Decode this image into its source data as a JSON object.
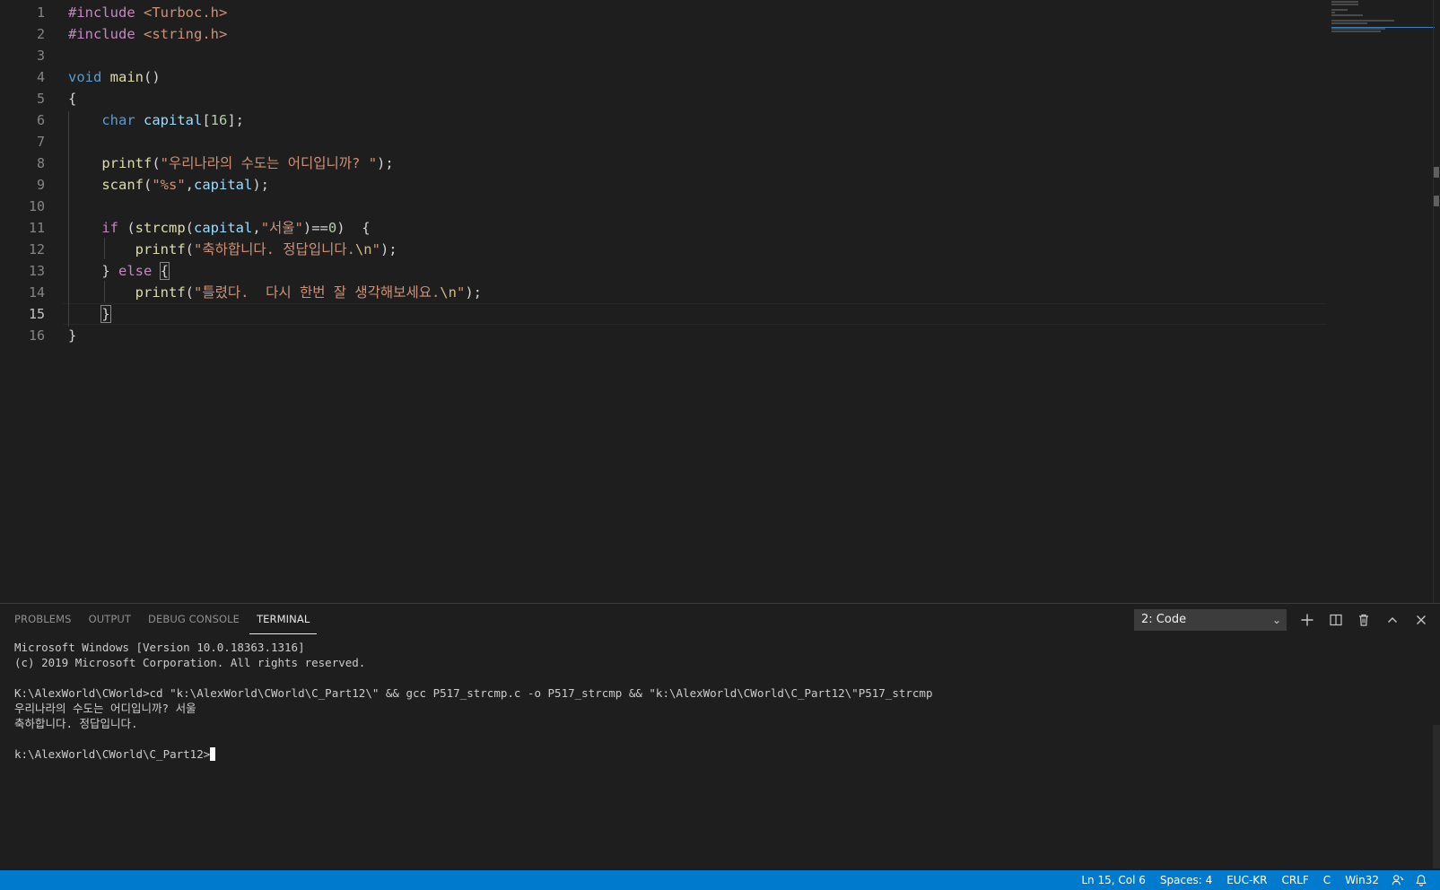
{
  "editor": {
    "line_numbers": [
      "1",
      "2",
      "3",
      "4",
      "5",
      "6",
      "7",
      "8",
      "9",
      "10",
      "11",
      "12",
      "13",
      "14",
      "15",
      "16"
    ],
    "active_line": "15",
    "lines": [
      [
        {
          "t": "ctrl",
          "v": "#include "
        },
        {
          "t": "str",
          "v": "<Turboc.h>"
        }
      ],
      [
        {
          "t": "ctrl",
          "v": "#include "
        },
        {
          "t": "str",
          "v": "<string.h>"
        }
      ],
      [],
      [
        {
          "t": "kw",
          "v": "void"
        },
        {
          "t": "pun",
          "v": " "
        },
        {
          "t": "fn",
          "v": "main"
        },
        {
          "t": "pun",
          "v": "()"
        }
      ],
      [
        {
          "t": "pun",
          "v": "{"
        }
      ],
      [
        {
          "t": "pun",
          "v": "    "
        },
        {
          "t": "kw",
          "v": "char"
        },
        {
          "t": "pun",
          "v": " "
        },
        {
          "t": "var",
          "v": "capital"
        },
        {
          "t": "pun",
          "v": "["
        },
        {
          "t": "num",
          "v": "16"
        },
        {
          "t": "pun",
          "v": "];"
        }
      ],
      [],
      [
        {
          "t": "pun",
          "v": "    "
        },
        {
          "t": "fn",
          "v": "printf"
        },
        {
          "t": "pun",
          "v": "("
        },
        {
          "t": "str",
          "v": "\"우리나라의 수도는 어디입니까? \""
        },
        {
          "t": "pun",
          "v": ");"
        }
      ],
      [
        {
          "t": "pun",
          "v": "    "
        },
        {
          "t": "fn",
          "v": "scanf"
        },
        {
          "t": "pun",
          "v": "("
        },
        {
          "t": "str",
          "v": "\"%s\""
        },
        {
          "t": "pun",
          "v": ","
        },
        {
          "t": "var",
          "v": "capital"
        },
        {
          "t": "pun",
          "v": ");"
        }
      ],
      [],
      [
        {
          "t": "pun",
          "v": "    "
        },
        {
          "t": "ctrl",
          "v": "if"
        },
        {
          "t": "pun",
          "v": " ("
        },
        {
          "t": "fn",
          "v": "strcmp"
        },
        {
          "t": "pun",
          "v": "("
        },
        {
          "t": "var",
          "v": "capital"
        },
        {
          "t": "pun",
          "v": ","
        },
        {
          "t": "str",
          "v": "\"서울\""
        },
        {
          "t": "pun",
          "v": ")=="
        },
        {
          "t": "num",
          "v": "0"
        },
        {
          "t": "pun",
          "v": ")  {"
        }
      ],
      [
        {
          "t": "pun",
          "v": "        "
        },
        {
          "t": "fn",
          "v": "printf"
        },
        {
          "t": "pun",
          "v": "("
        },
        {
          "t": "str",
          "v": "\"축하합니다. 정답입니다."
        },
        {
          "t": "esc",
          "v": "\\n"
        },
        {
          "t": "str",
          "v": "\""
        },
        {
          "t": "pun",
          "v": ");"
        }
      ],
      [
        {
          "t": "pun",
          "v": "    } "
        },
        {
          "t": "ctrl",
          "v": "else"
        },
        {
          "t": "pun",
          "v": " "
        },
        {
          "t": "box",
          "v": "{"
        }
      ],
      [
        {
          "t": "pun",
          "v": "        "
        },
        {
          "t": "fn",
          "v": "printf"
        },
        {
          "t": "pun",
          "v": "("
        },
        {
          "t": "str",
          "v": "\"틀렸다.  다시 한번 잘 생각해보세요."
        },
        {
          "t": "esc",
          "v": "\\n"
        },
        {
          "t": "str",
          "v": "\""
        },
        {
          "t": "pun",
          "v": ");"
        }
      ],
      [
        {
          "t": "pun",
          "v": "    "
        },
        {
          "t": "box",
          "v": "}"
        }
      ],
      [
        {
          "t": "pun",
          "v": "}"
        }
      ]
    ]
  },
  "panel": {
    "tabs": [
      "PROBLEMS",
      "OUTPUT",
      "DEBUG CONSOLE",
      "TERMINAL"
    ],
    "active_tab": "TERMINAL",
    "terminal_selector": "2: Code",
    "terminal_lines": [
      "Microsoft Windows [Version 10.0.18363.1316]",
      "(c) 2019 Microsoft Corporation. All rights reserved.",
      "",
      "K:\\AlexWorld\\CWorld>cd \"k:\\AlexWorld\\CWorld\\C_Part12\\\" && gcc P517_strcmp.c -o P517_strcmp && \"k:\\AlexWorld\\CWorld\\C_Part12\\\"P517_strcmp",
      "우리나라의 수도는 어디입니까? 서울",
      "축하합니다. 정답입니다.",
      ""
    ],
    "prompt": "k:\\AlexWorld\\CWorld\\C_Part12>",
    "icons": {
      "new_terminal": "plus-icon",
      "split_terminal": "split-icon",
      "kill_terminal": "trash-icon",
      "maximize_panel": "chevron-up-icon",
      "close_panel": "close-icon"
    }
  },
  "statusbar": {
    "position": "Ln 15, Col 6",
    "spaces": "Spaces: 4",
    "encoding": "EUC-KR",
    "eol": "CRLF",
    "language": "C",
    "platform": "Win32"
  },
  "colors": {
    "editor_bg": "#1e1e1e",
    "statusbar_bg": "#007acc",
    "keyword": "#569cd6",
    "control": "#c586c0",
    "function": "#dcdcaa",
    "variable": "#9cdcfe",
    "string": "#ce9178",
    "number": "#b5cea8"
  }
}
